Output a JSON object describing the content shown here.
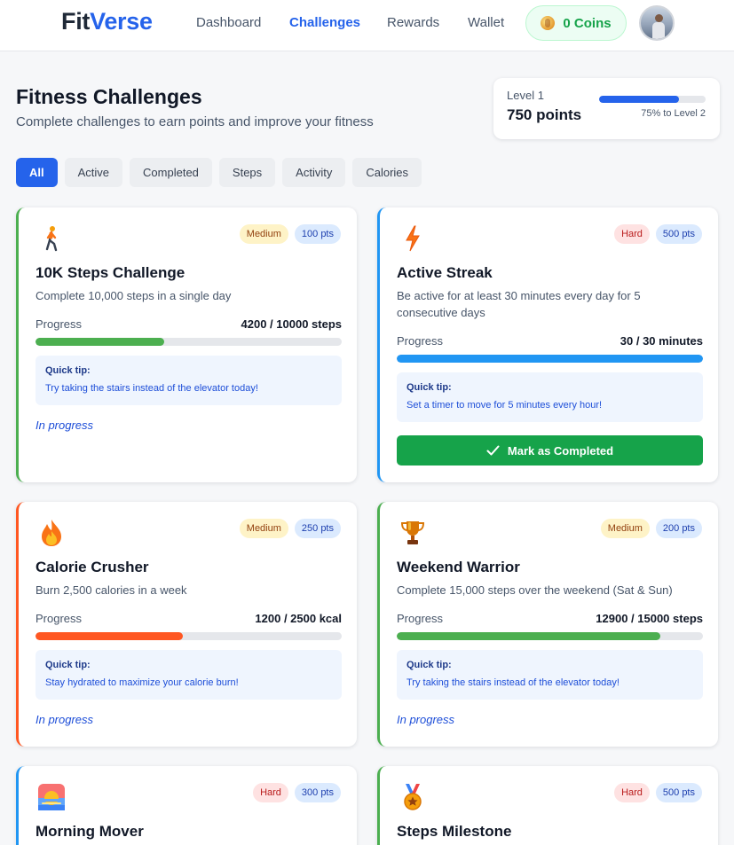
{
  "brand": {
    "part1": "Fit",
    "part2": "Verse"
  },
  "nav": {
    "links": [
      "Dashboard",
      "Challenges",
      "Rewards",
      "Wallet"
    ],
    "active": "Challenges",
    "coins_label": "0 Coins"
  },
  "header": {
    "title": "Fitness Challenges",
    "subtitle": "Complete challenges to earn points and improve your fitness"
  },
  "level": {
    "label": "Level 1",
    "points": "750 points",
    "progress_fraction": 0.75,
    "next_label": "75% to Level 2"
  },
  "filters": {
    "tabs": [
      "All",
      "Active",
      "Completed",
      "Steps",
      "Activity",
      "Calories"
    ],
    "active": "All"
  },
  "colors": {
    "primary": "#2563eb",
    "success": "#16a34a",
    "steps": "#4caf50",
    "activity": "#2196f3",
    "calories": "#ff5722"
  },
  "cards": [
    {
      "icon": "walking-person-icon",
      "difficulty": "Medium",
      "points": "100 pts",
      "title": "10K Steps Challenge",
      "description": "Complete 10,000 steps in a single day",
      "progress_label": "Progress",
      "progress_value": "4200 / 10000 steps",
      "progress_fraction": 0.42,
      "tip_title": "Quick tip:",
      "tip_text": "Try taking the stairs instead of the elevator today!",
      "status": "In progress",
      "accent": "#4caf50"
    },
    {
      "icon": "lightning-icon",
      "difficulty": "Hard",
      "points": "500 pts",
      "title": "Active Streak",
      "description": "Be active for at least 30 minutes every day for 5 consecutive days",
      "progress_label": "Progress",
      "progress_value": "30 / 30 minutes",
      "progress_fraction": 1.0,
      "tip_title": "Quick tip:",
      "tip_text": "Set a timer to move for 5 minutes every hour!",
      "button": "Mark as Completed",
      "accent": "#2196f3"
    },
    {
      "icon": "fire-icon",
      "difficulty": "Medium",
      "points": "250 pts",
      "title": "Calorie Crusher",
      "description": "Burn 2,500 calories in a week",
      "progress_label": "Progress",
      "progress_value": "1200 / 2500 kcal",
      "progress_fraction": 0.48,
      "tip_title": "Quick tip:",
      "tip_text": "Stay hydrated to maximize your calorie burn!",
      "status": "In progress",
      "accent": "#ff5722"
    },
    {
      "icon": "trophy-icon",
      "difficulty": "Medium",
      "points": "200 pts",
      "title": "Weekend Warrior",
      "description": "Complete 15,000 steps over the weekend (Sat & Sun)",
      "progress_label": "Progress",
      "progress_value": "12900 / 15000 steps",
      "progress_fraction": 0.86,
      "tip_title": "Quick tip:",
      "tip_text": "Try taking the stairs instead of the elevator today!",
      "status": "In progress",
      "accent": "#4caf50"
    },
    {
      "icon": "sunrise-icon",
      "difficulty": "Hard",
      "points": "300 pts",
      "title": "Morning Mover",
      "accent": "#2196f3"
    },
    {
      "icon": "medal-icon",
      "difficulty": "Hard",
      "points": "500 pts",
      "title": "Steps Milestone",
      "accent": "#4caf50"
    }
  ]
}
